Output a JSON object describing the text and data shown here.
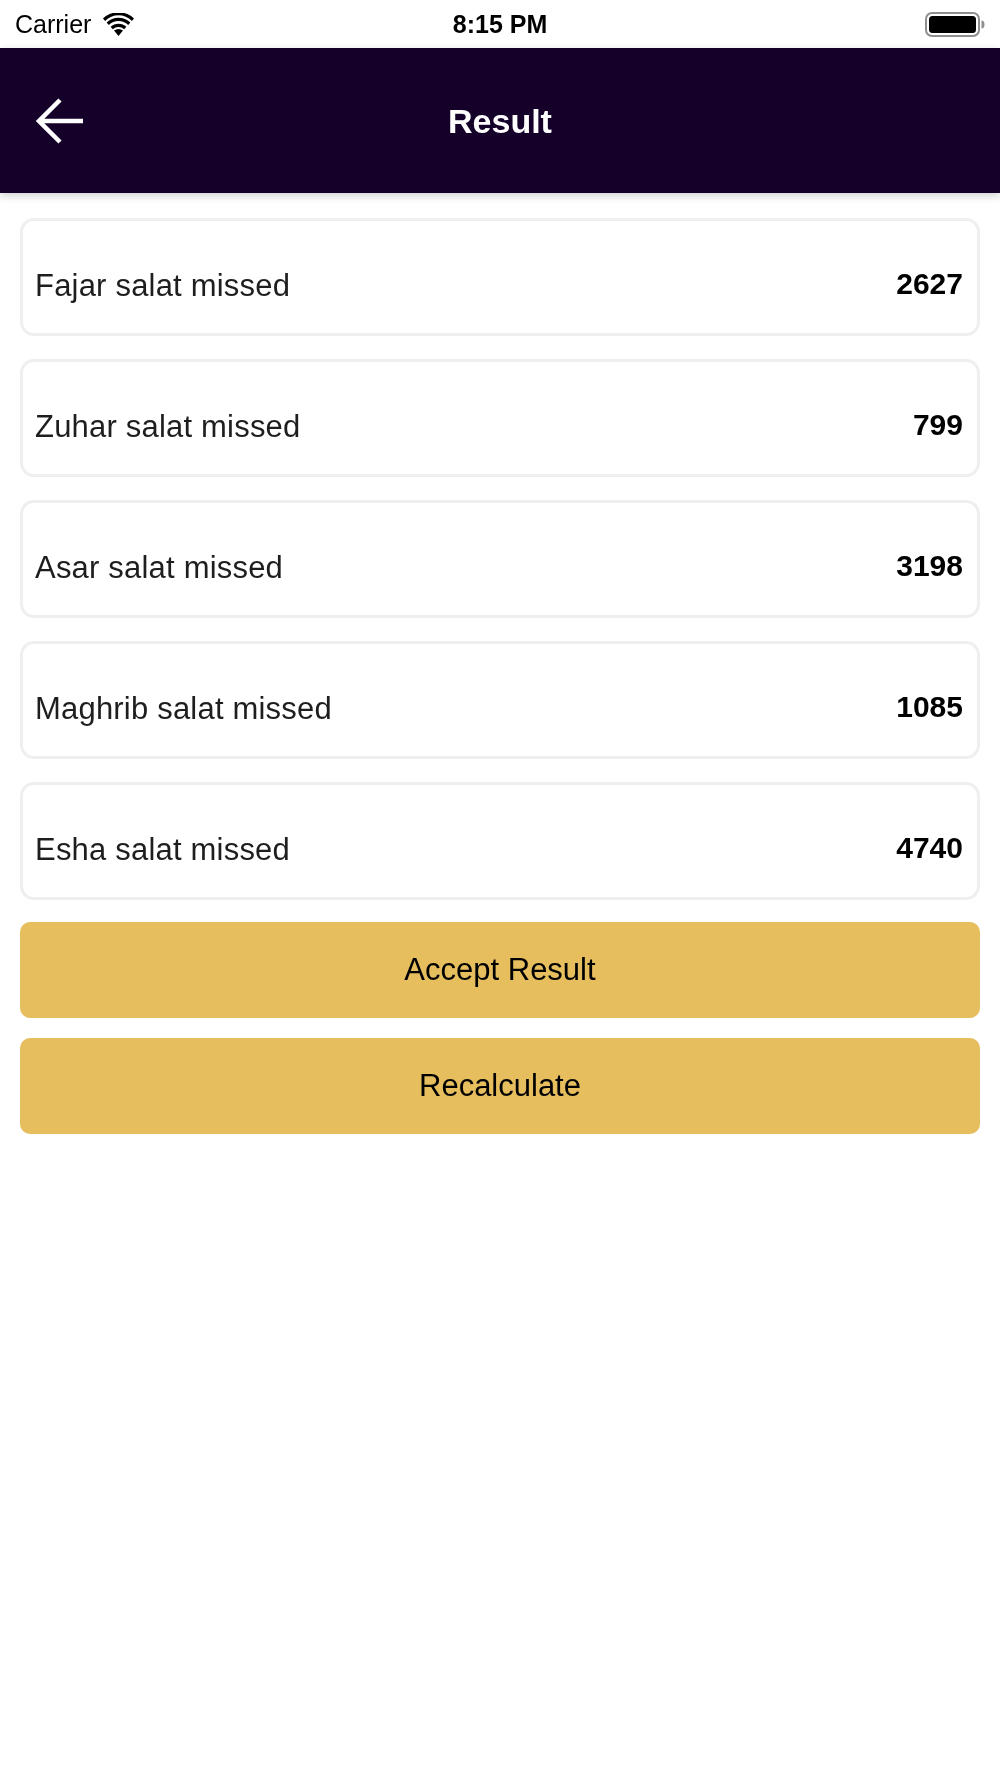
{
  "status_bar": {
    "carrier": "Carrier",
    "time": "8:15 PM"
  },
  "header": {
    "title": "Result"
  },
  "results": [
    {
      "label": "Fajar salat missed",
      "count": "2627"
    },
    {
      "label": "Zuhar salat missed",
      "count": "799"
    },
    {
      "label": "Asar salat missed",
      "count": "3198"
    },
    {
      "label": "Maghrib salat missed",
      "count": "1085"
    },
    {
      "label": "Esha salat missed",
      "count": "4740"
    }
  ],
  "buttons": [
    {
      "label": "Accept Result"
    },
    {
      "label": "Recalculate"
    }
  ]
}
